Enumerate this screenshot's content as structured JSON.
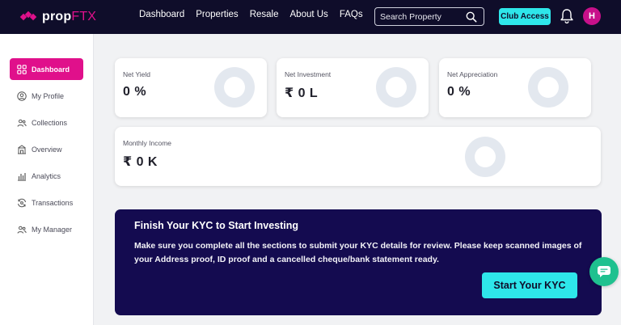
{
  "brand": {
    "name_part1": "prop",
    "name_part2": "FTX",
    "accent": "#e0108b"
  },
  "nav": [
    "Dashboard",
    "Properties",
    "Resale",
    "About Us",
    "FAQs"
  ],
  "search": {
    "placeholder": "Search Property"
  },
  "header": {
    "club_access": "Club Access",
    "avatar_initial": "H"
  },
  "sidebar": {
    "items": [
      {
        "label": "Dashboard",
        "icon": "dashboard-icon",
        "active": true
      },
      {
        "label": "My Profile",
        "icon": "profile-icon"
      },
      {
        "label": "Collections",
        "icon": "collections-icon"
      },
      {
        "label": "Overview",
        "icon": "overview-icon"
      },
      {
        "label": "Analytics",
        "icon": "analytics-icon"
      },
      {
        "label": "Transactions",
        "icon": "transactions-icon"
      },
      {
        "label": "My Manager",
        "icon": "manager-icon"
      }
    ]
  },
  "stats": {
    "net_yield": {
      "label": "Net Yield",
      "value": "0 %"
    },
    "net_investment": {
      "label": "Net Investment",
      "value": "₹ 0 L"
    },
    "net_appreciation": {
      "label": "Net Appreciation",
      "value": "0 %"
    },
    "monthly_income": {
      "label": "Monthly Income",
      "value": "₹ 0 K"
    }
  },
  "kyc": {
    "title": "Finish Your KYC to Start Investing",
    "body": "Make sure you complete all the sections to submit your KYC details for review. Please keep scanned images of your Address proof, ID proof and a cancelled cheque/bank statement ready.",
    "button": "Start Your KYC"
  },
  "colors": {
    "header_bg": "#0f0d2a",
    "cyan": "#2ee6ea",
    "kyc_bg": "#140b50",
    "chat": "#1fc18f"
  }
}
